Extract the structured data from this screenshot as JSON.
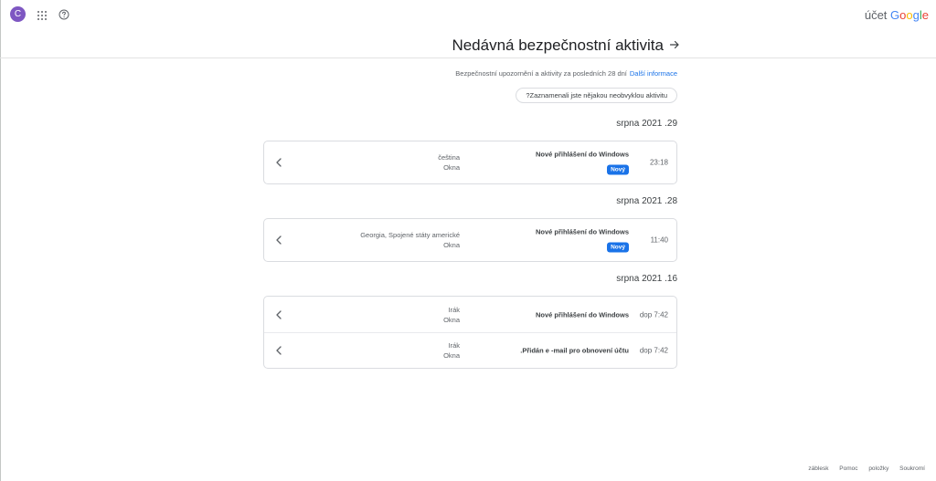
{
  "topbar": {
    "avatar_letter": "C",
    "brand_prefix": "účet",
    "brand_logo": [
      "G",
      "o",
      "o",
      "g",
      "l",
      "e"
    ],
    "avatar_color": "#7e57c2"
  },
  "header": {
    "title": "Nedávná bezpečnostní aktivita"
  },
  "intro": {
    "text": "Bezpečnostní upozornění a aktivity za posledních 28 dní",
    "link": "Další informace",
    "button": "?Zaznamenali jste nějakou neobvyklou aktivitu"
  },
  "groups": [
    {
      "date": "srpna 2021 .29",
      "items": [
        {
          "meta1": "čeština",
          "meta2": "Okna",
          "title": "Nové přihlášení do Windows",
          "badge": "Nový",
          "time": "23:18"
        }
      ]
    },
    {
      "date": "srpna 2021 .28",
      "items": [
        {
          "meta1": "Georgia, Spojené státy americké",
          "meta2": "Okna",
          "title": "Nové přihlášení do Windows",
          "badge": "Nový",
          "time": "11:40"
        }
      ]
    },
    {
      "date": "srpna 2021 .16",
      "items": [
        {
          "meta1": "Irák",
          "meta2": "Okna",
          "title": "Nové přihlášení do Windows",
          "time": "dop 7:42"
        },
        {
          "meta1": "Irák",
          "meta2": "Okna",
          "title": ".Přidán e -mail pro obnovení účtu",
          "time": "dop 7:42"
        }
      ]
    }
  ],
  "footer": [
    "záblesk",
    "Pomoc",
    "položky",
    "Soukromí"
  ],
  "colors": {
    "accent": "#1a73e8",
    "badge": "#1a73e8"
  }
}
